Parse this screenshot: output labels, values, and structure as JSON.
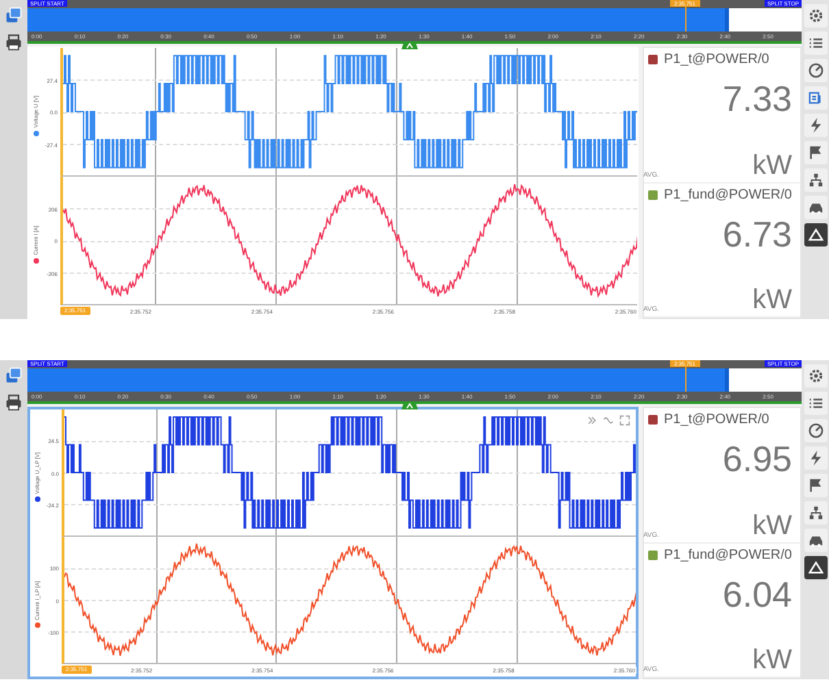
{
  "panels": [
    {
      "selected": false,
      "timeline": {
        "start_label": "SPLIT START",
        "stop_label": "SPLIT STOP",
        "marker_label": "2:35.751",
        "level": 0.9,
        "ticks": [
          "0:00",
          "0:10",
          "0:20",
          "0:30",
          "0:40",
          "0:50",
          "1:00",
          "1:10",
          "1:20",
          "1:30",
          "1:40",
          "1:50",
          "2:00",
          "2:10",
          "2:20",
          "2:30",
          "2:40",
          "2:50"
        ]
      },
      "charts": [
        {
          "kind": "voltage",
          "axis_title": "Voltage U [V]",
          "color": "#3b8cf0",
          "y_ticks": [
            "27.4",
            "0.0",
            "-27.4"
          ],
          "stat": "AVG."
        },
        {
          "kind": "current",
          "axis_title": "Current I [A]",
          "color": "#f0365a",
          "y_ticks": [
            "206",
            "0",
            "-206"
          ],
          "stat": "AVG."
        }
      ],
      "cursor_label": "2:35.751",
      "x_ticks": [
        "2:35.752",
        "2:35.754",
        "2:35.756",
        "2:35.758",
        "2:35.760"
      ],
      "values": [
        {
          "name": "P1_t@POWER/0",
          "color": "#a33a3a",
          "value": "7.33",
          "unit": "kW"
        },
        {
          "name": "P1_fund@POWER/0",
          "color": "#7aa040",
          "value": "6.73",
          "unit": "kW"
        }
      ],
      "tools": [
        {
          "kind": "gear",
          "selected": false
        },
        {
          "kind": "list",
          "selected": false
        },
        {
          "kind": "gauge",
          "selected": false
        },
        {
          "kind": "chart",
          "selected": false
        },
        {
          "kind": "bolt",
          "selected": false
        },
        {
          "kind": "flag",
          "selected": false
        },
        {
          "kind": "tree",
          "selected": false
        },
        {
          "kind": "car",
          "selected": false
        },
        {
          "kind": "triangle",
          "selected": true
        }
      ]
    },
    {
      "selected": true,
      "timeline": {
        "start_label": "SPLIT START",
        "stop_label": "SPLIT STOP",
        "marker_label": "2:35.751",
        "level": 0.9,
        "ticks": [
          "0:00",
          "0:10",
          "0:20",
          "0:30",
          "0:40",
          "0:50",
          "1:00",
          "1:10",
          "1:20",
          "1:30",
          "1:40",
          "1:50",
          "2:00",
          "2:10",
          "2:20",
          "2:30",
          "2:40",
          "2:50"
        ]
      },
      "charts": [
        {
          "kind": "voltage",
          "axis_title": "Voltage U_LP [V]",
          "color": "#1f3fe0",
          "y_ticks": [
            "24.5",
            "0.0",
            "-24.2"
          ],
          "stat": "AVG."
        },
        {
          "kind": "current",
          "axis_title": "Current I_LP [A]",
          "color": "#f0502a",
          "y_ticks": [
            "100",
            "0",
            "-100"
          ],
          "stat": "AVG."
        }
      ],
      "cursor_label": "2:35.751",
      "x_ticks": [
        "2:35.752",
        "2:35.754",
        "2:35.756",
        "2:35.758",
        "2:35.760"
      ],
      "values": [
        {
          "name": "P1_t@POWER/0",
          "color": "#a33a3a",
          "value": "6.95",
          "unit": "kW"
        },
        {
          "name": "P1_fund@POWER/0",
          "color": "#7aa040",
          "value": "6.04",
          "unit": "kW"
        }
      ],
      "tools": [
        {
          "kind": "gear",
          "selected": false
        },
        {
          "kind": "list",
          "selected": false
        },
        {
          "kind": "gauge",
          "selected": false
        },
        {
          "kind": "bolt",
          "selected": false
        },
        {
          "kind": "flag",
          "selected": false
        },
        {
          "kind": "tree",
          "selected": false
        },
        {
          "kind": "car",
          "selected": false
        },
        {
          "kind": "triangle",
          "selected": true
        }
      ]
    }
  ]
}
